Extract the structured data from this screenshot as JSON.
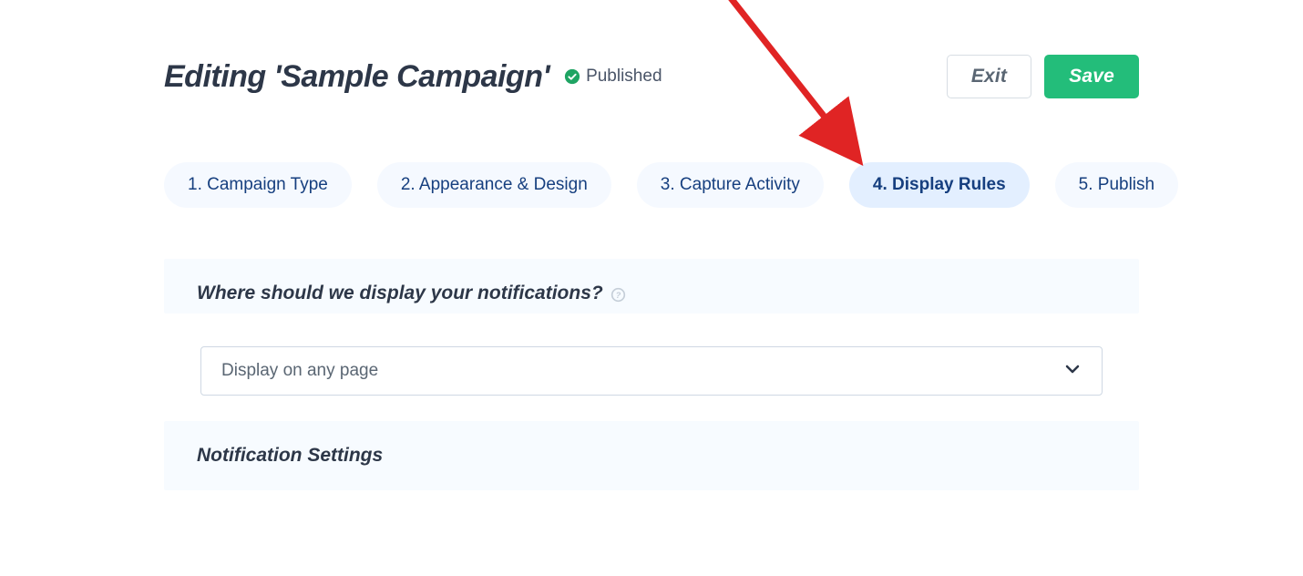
{
  "header": {
    "title": "Editing 'Sample Campaign'",
    "status_label": "Published",
    "exit_label": "Exit",
    "save_label": "Save"
  },
  "tabs": [
    {
      "label": "1. Campaign Type"
    },
    {
      "label": "2. Appearance & Design"
    },
    {
      "label": "3. Capture Activity"
    },
    {
      "label": "4. Display Rules",
      "active": true
    },
    {
      "label": "5. Publish"
    }
  ],
  "panel_display": {
    "title": "Where should we display your notifications?",
    "dropdown_value": "Display on any page"
  },
  "panel_settings": {
    "title": "Notification Settings"
  }
}
